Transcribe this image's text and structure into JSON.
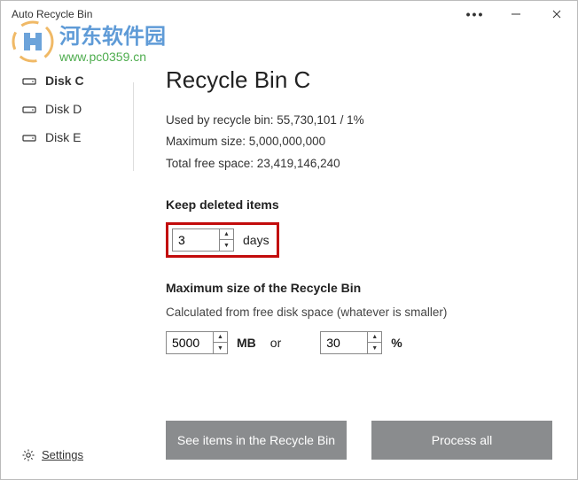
{
  "title": "Auto Recycle Bin",
  "watermark": {
    "text": "河东软件园",
    "url": "www.pc0359.cn"
  },
  "sidebar": {
    "items": [
      {
        "label": "Disk C",
        "active": true
      },
      {
        "label": "Disk D",
        "active": false
      },
      {
        "label": "Disk E",
        "active": false
      }
    ],
    "settings_label": "Settings"
  },
  "main": {
    "heading": "Recycle Bin C",
    "info": {
      "used_label": "Used by recycle bin: 55,730,101 / 1%",
      "max_label": "Maximum size: 5,000,000,000",
      "free_label": "Total free space: 23,419,146,240"
    },
    "keep": {
      "label": "Keep deleted items",
      "value": "3",
      "unit": "days"
    },
    "maxsize": {
      "label": "Maximum size of the Recycle Bin",
      "subtext": "Calculated from free disk space (whatever is smaller)",
      "mb_value": "5000",
      "mb_unit": "MB",
      "or_label": "or",
      "pct_value": "30",
      "pct_unit": "%"
    }
  },
  "buttons": {
    "see_items": "See items in the Recycle Bin",
    "process_all": "Process all"
  }
}
